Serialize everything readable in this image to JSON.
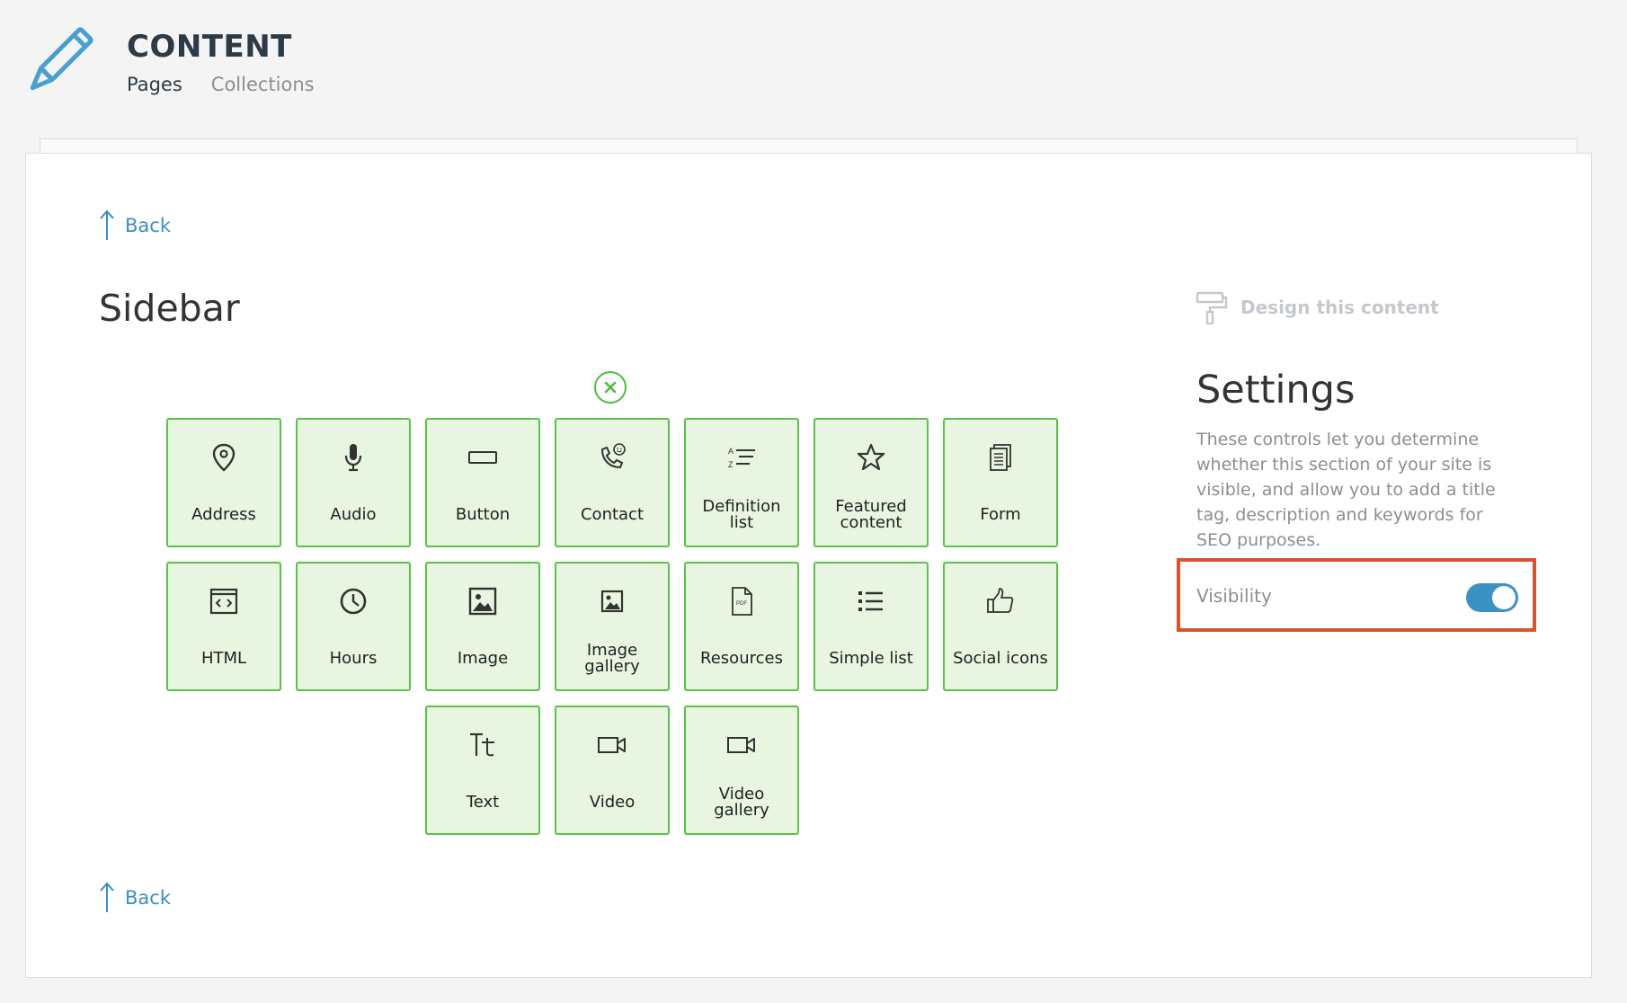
{
  "header": {
    "title": "CONTENT",
    "tabs": [
      {
        "label": "Pages",
        "active": true
      },
      {
        "label": "Collections",
        "active": false
      }
    ]
  },
  "main": {
    "back_label": "Back",
    "section_title": "Sidebar",
    "tiles": [
      {
        "label": "Address",
        "icon": "map-pin-icon"
      },
      {
        "label": "Audio",
        "icon": "microphone-icon"
      },
      {
        "label": "Button",
        "icon": "button-icon"
      },
      {
        "label": "Contact",
        "icon": "phone-icon"
      },
      {
        "label": "Definition list",
        "icon": "definition-list-icon"
      },
      {
        "label": "Featured content",
        "icon": "star-icon"
      },
      {
        "label": "Form",
        "icon": "form-icon"
      },
      {
        "label": "HTML",
        "icon": "code-icon"
      },
      {
        "label": "Hours",
        "icon": "clock-icon"
      },
      {
        "label": "Image",
        "icon": "image-icon"
      },
      {
        "label": "Image gallery",
        "icon": "image-gallery-icon"
      },
      {
        "label": "Resources",
        "icon": "pdf-document-icon"
      },
      {
        "label": "Simple list",
        "icon": "list-icon"
      },
      {
        "label": "Social icons",
        "icon": "thumbs-up-icon"
      },
      {
        "label": "Text",
        "icon": "text-icon"
      },
      {
        "label": "Video",
        "icon": "video-camera-icon"
      },
      {
        "label": "Video gallery",
        "icon": "video-gallery-icon"
      }
    ]
  },
  "settings_panel": {
    "design_link": "Design this content",
    "title": "Settings",
    "description": "These controls let you determine whether this section of your site is visible, and allow you to add a title tag, description and keywords for SEO purposes.",
    "visibility_label": "Visibility",
    "visibility_on": true
  },
  "colors": {
    "accent_blue": "#3a91c2",
    "tile_bg": "#e8f5e0",
    "tile_border": "#5cc04a",
    "highlight_border": "#d9532c"
  }
}
